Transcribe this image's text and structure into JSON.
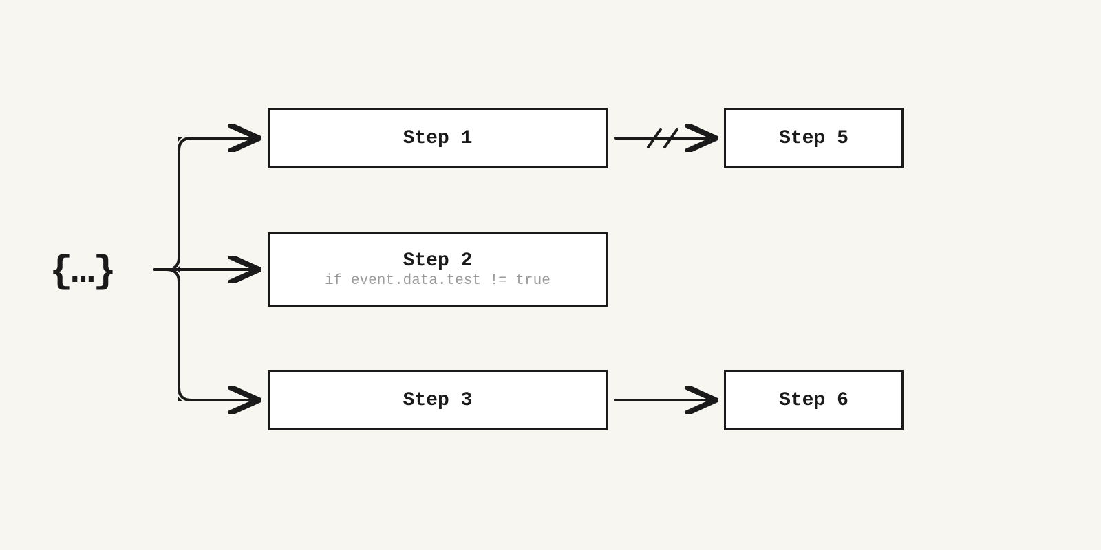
{
  "source": {
    "label": "{…}"
  },
  "steps": {
    "step1": {
      "title": "Step 1"
    },
    "step2": {
      "title": "Step 2",
      "condition": "if event.data.test != true"
    },
    "step3": {
      "title": "Step 3"
    },
    "step5": {
      "title": "Step 5"
    },
    "step6": {
      "title": "Step 6"
    }
  },
  "layout": {
    "background": "#f7f6f0",
    "box_fill": "#ffffff",
    "stroke": "#1a1a1a",
    "muted": "#9a9a9a"
  },
  "connectors": [
    {
      "from": "source",
      "to": "step1",
      "style": "solid"
    },
    {
      "from": "source",
      "to": "step2",
      "style": "solid"
    },
    {
      "from": "source",
      "to": "step3",
      "style": "solid"
    },
    {
      "from": "step1",
      "to": "step5",
      "style": "broken"
    },
    {
      "from": "step3",
      "to": "step6",
      "style": "solid"
    }
  ]
}
